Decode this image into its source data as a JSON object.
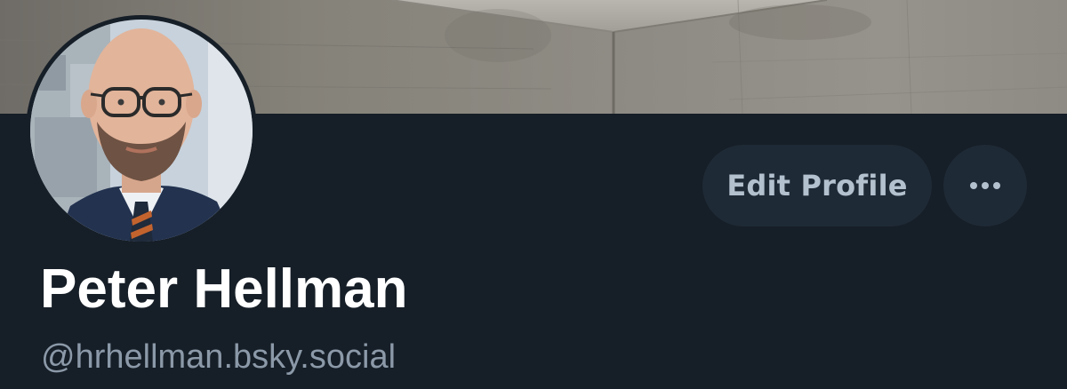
{
  "profile": {
    "display_name": "Peter Hellman",
    "handle": "@hrhellman.bsky.social",
    "banner_icon": "concrete-wall-banner",
    "avatar_icon": "profile-photo"
  },
  "actions": {
    "edit_label": "Edit Profile",
    "more_icon": "ellipsis-icon"
  },
  "colors": {
    "background": "#161e27",
    "button_bg": "#1e2a36",
    "button_text": "#b3c0cd",
    "name_text": "#ffffff",
    "handle_text": "#8b99a8"
  }
}
